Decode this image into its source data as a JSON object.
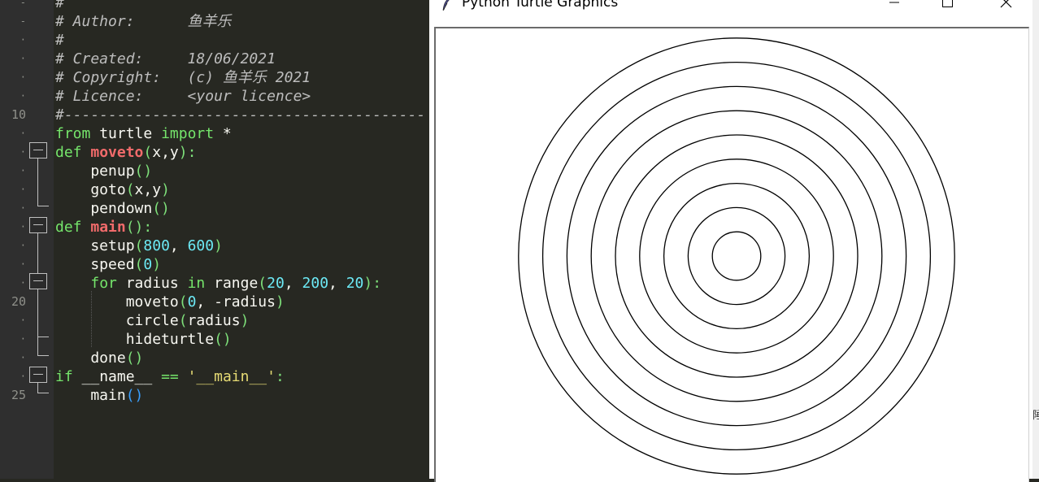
{
  "editor": {
    "line_numbers": [
      {
        "row": 0,
        "text": "-"
      },
      {
        "row": 1,
        "text": "-"
      },
      {
        "row": 2,
        "text": "·"
      },
      {
        "row": 3,
        "text": "·"
      },
      {
        "row": 4,
        "text": "·"
      },
      {
        "row": 5,
        "text": "·"
      },
      {
        "row": 6,
        "text": "10"
      },
      {
        "row": 7,
        "text": "·"
      },
      {
        "row": 8,
        "text": "·"
      },
      {
        "row": 9,
        "text": "·"
      },
      {
        "row": 10,
        "text": "·"
      },
      {
        "row": 11,
        "text": "·"
      },
      {
        "row": 12,
        "text": "·"
      },
      {
        "row": 13,
        "text": "·"
      },
      {
        "row": 14,
        "text": "·"
      },
      {
        "row": 15,
        "text": "·"
      },
      {
        "row": 16,
        "text": "20"
      },
      {
        "row": 17,
        "text": "·"
      },
      {
        "row": 18,
        "text": "·"
      },
      {
        "row": 19,
        "text": "·"
      },
      {
        "row": 20,
        "text": "·"
      },
      {
        "row": 21,
        "text": "25"
      }
    ],
    "lines": [
      [
        {
          "t": "#",
          "c": "com"
        }
      ],
      [
        {
          "t": "# Author:      鱼羊乐",
          "c": "com"
        }
      ],
      [
        {
          "t": "#",
          "c": "com"
        }
      ],
      [
        {
          "t": "# Created:     18/06/2021",
          "c": "com"
        }
      ],
      [
        {
          "t": "# Copyright:   (c) 鱼羊乐 2021",
          "c": "com"
        }
      ],
      [
        {
          "t": "# Licence:     <your licence>",
          "c": "com"
        }
      ],
      [
        {
          "t": "#-----------------------------------------",
          "c": "com"
        }
      ],
      [
        {
          "t": "from",
          "c": "kw"
        },
        {
          "t": " turtle ",
          "c": "plain"
        },
        {
          "t": "import",
          "c": "kw"
        },
        {
          "t": " *",
          "c": "plain"
        }
      ],
      [
        {
          "t": "def ",
          "c": "kw"
        },
        {
          "t": "moveto",
          "c": "fn"
        },
        {
          "t": "(",
          "c": "punc"
        },
        {
          "t": "x,y",
          "c": "plain"
        },
        {
          "t": "):",
          "c": "punc"
        }
      ],
      [
        {
          "t": "    penup",
          "c": "call"
        },
        {
          "t": "()",
          "c": "punc"
        }
      ],
      [
        {
          "t": "    goto",
          "c": "call"
        },
        {
          "t": "(",
          "c": "punc"
        },
        {
          "t": "x,y",
          "c": "plain"
        },
        {
          "t": ")",
          "c": "punc"
        }
      ],
      [
        {
          "t": "    pendown",
          "c": "call"
        },
        {
          "t": "()",
          "c": "punc"
        }
      ],
      [
        {
          "t": "def ",
          "c": "kw"
        },
        {
          "t": "main",
          "c": "fn"
        },
        {
          "t": "():",
          "c": "punc"
        }
      ],
      [
        {
          "t": "    setup",
          "c": "call"
        },
        {
          "t": "(",
          "c": "punc"
        },
        {
          "t": "800",
          "c": "num"
        },
        {
          "t": ", ",
          "c": "plain"
        },
        {
          "t": "600",
          "c": "num"
        },
        {
          "t": ")",
          "c": "punc"
        }
      ],
      [
        {
          "t": "    speed",
          "c": "call"
        },
        {
          "t": "(",
          "c": "punc"
        },
        {
          "t": "0",
          "c": "num"
        },
        {
          "t": ")",
          "c": "punc"
        }
      ],
      [
        {
          "t": "    ",
          "c": "plain"
        },
        {
          "t": "for",
          "c": "kw"
        },
        {
          "t": " radius ",
          "c": "plain"
        },
        {
          "t": "in",
          "c": "kw"
        },
        {
          "t": " range",
          "c": "call"
        },
        {
          "t": "(",
          "c": "punc"
        },
        {
          "t": "20",
          "c": "num"
        },
        {
          "t": ", ",
          "c": "plain"
        },
        {
          "t": "200",
          "c": "num"
        },
        {
          "t": ", ",
          "c": "plain"
        },
        {
          "t": "20",
          "c": "num"
        },
        {
          "t": "):",
          "c": "punc"
        }
      ],
      [
        {
          "t": "        moveto",
          "c": "call"
        },
        {
          "t": "(",
          "c": "punc"
        },
        {
          "t": "0",
          "c": "num"
        },
        {
          "t": ", -radius",
          "c": "plain"
        },
        {
          "t": ")",
          "c": "punc"
        }
      ],
      [
        {
          "t": "        circle",
          "c": "call"
        },
        {
          "t": "(",
          "c": "punc"
        },
        {
          "t": "radius",
          "c": "plain"
        },
        {
          "t": ")",
          "c": "punc"
        }
      ],
      [
        {
          "t": "        hideturtle",
          "c": "call"
        },
        {
          "t": "()",
          "c": "punc"
        }
      ],
      [
        {
          "t": "    done",
          "c": "call"
        },
        {
          "t": "()",
          "c": "punc"
        }
      ],
      [
        {
          "t": "if",
          "c": "kw"
        },
        {
          "t": " __name__ ",
          "c": "plain"
        },
        {
          "t": "==",
          "c": "kw"
        },
        {
          "t": " ",
          "c": "plain"
        },
        {
          "t": "'__main__'",
          "c": "str"
        },
        {
          "t": ":",
          "c": "punc"
        }
      ],
      [
        {
          "t": "    main",
          "c": "call"
        },
        {
          "t": "()",
          "c": "cur"
        }
      ]
    ]
  },
  "turtle_window": {
    "title": "Python Turtle Graphics",
    "icons": {
      "app": "feather-icon",
      "minimize": "minimize-icon",
      "maximize": "maximize-icon",
      "close": "close-icon"
    },
    "drawing": {
      "shape": "concentric-circles",
      "radii": [
        20,
        40,
        60,
        80,
        100,
        120,
        140,
        160,
        180
      ],
      "pen_color": "#000000",
      "background": "#ffffff"
    }
  },
  "edge_glyph": "陲"
}
